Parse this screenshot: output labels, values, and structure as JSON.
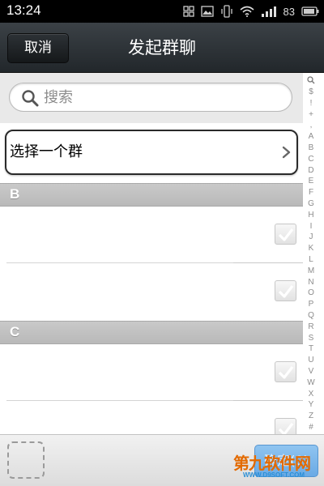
{
  "status_bar": {
    "time": "13:24",
    "battery": "83",
    "icons": [
      "grid-icon",
      "image-icon",
      "vibrate-icon",
      "wifi-icon",
      "signal-icon",
      "battery-icon"
    ]
  },
  "header": {
    "cancel_label": "取消",
    "title": "发起群聊"
  },
  "search": {
    "placeholder": "搜索"
  },
  "select_group": {
    "label": "选择一个群"
  },
  "sections": [
    {
      "label": "B",
      "contacts": [
        "",
        ""
      ]
    },
    {
      "label": "C",
      "contacts": [
        "",
        ""
      ]
    }
  ],
  "index_bar": {
    "letters": [
      "$",
      "!",
      "+",
      ",",
      "A",
      "B",
      "C",
      "D",
      "E",
      "F",
      "G",
      "H",
      "I",
      "J",
      "K",
      "L",
      "M",
      "N",
      "O",
      "P",
      "Q",
      "R",
      "S",
      "T",
      "U",
      "V",
      "W",
      "X",
      "Y",
      "Z",
      "#"
    ]
  },
  "bottom_bar": {
    "confirm_label": "确定(0)"
  },
  "watermark": {
    "text": "第九软件网",
    "url": "WWW.D9SOFT.COM"
  },
  "colors": {
    "header_bg": "#2e3438",
    "confirm_bg": "#7ab7ea",
    "section_bg": "#c1c1c1"
  }
}
